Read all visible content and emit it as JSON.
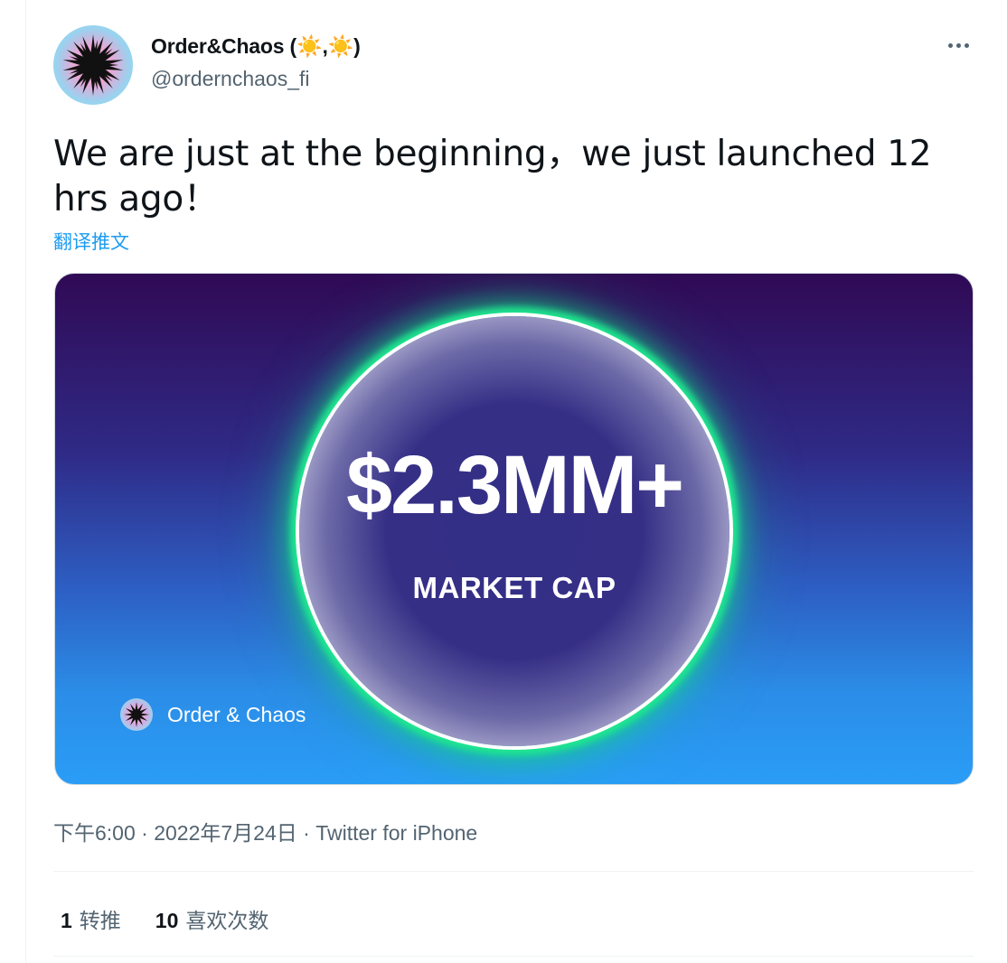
{
  "author": {
    "display_name": "Order&Chaos (",
    "sun_glyph": "☀️",
    "separator": ",",
    "close_paren": ")",
    "handle": "@ordernchaos_fi",
    "avatar_icon": "sunburst-logo-icon"
  },
  "tweet": {
    "text": "We are just at the beginning，we just launched 12 hrs ago！",
    "translate_label": "翻译推文"
  },
  "media": {
    "amount": "$2.3MM+",
    "caption": "MARKET CAP",
    "brand_name": "Order & Chaos"
  },
  "meta": {
    "time": "下午6:00",
    "dot1": " · ",
    "date": "2022年7月24日",
    "dot2": " · ",
    "source": "Twitter for iPhone"
  },
  "stats": {
    "retweets_count": "1",
    "retweets_label": "转推",
    "likes_count": "10",
    "likes_label": "喜欢次数"
  },
  "colors": {
    "accent": "#1d9bf0",
    "secondary_text": "#536471",
    "glow_green": "#1fe88f"
  }
}
